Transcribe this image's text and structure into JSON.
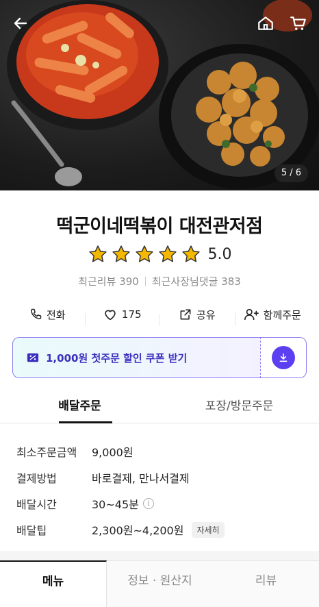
{
  "hero": {
    "counter": "5 / 6",
    "icons": {
      "back": "back-arrow-icon",
      "home": "home-icon",
      "cart": "cart-icon"
    }
  },
  "store": {
    "name": "떡군이네떡볶이 대전관저점",
    "rating": "5.0",
    "stars": 5,
    "recent_reviews": "최근리뷰 390",
    "owner_replies": "최근사장님댓글 383"
  },
  "actions": {
    "phone": "전화",
    "like_count": "175",
    "share": "공유",
    "group_order": "함께주문"
  },
  "coupon": {
    "label": "1,000원 첫주문 할인 쿠폰 받기"
  },
  "order_tabs": [
    "배달주문",
    "포장/방문주문"
  ],
  "info": {
    "min_order_label": "최소주문금액",
    "min_order_value": "9,000원",
    "payment_label": "결제방법",
    "payment_value": "바로결제, 만나서결제",
    "delivery_time_label": "배달시간",
    "delivery_time_value": "30~45분",
    "tip_label": "배달팁",
    "tip_value": "2,300원~4,200원",
    "detail_button": "자세히"
  },
  "bottom_tabs": [
    "메뉴",
    "정보 · 원산지",
    "리뷰"
  ],
  "colors": {
    "accent": "#5b3ff0",
    "star": "#f5b800",
    "coupon_text": "#3a2fbf"
  }
}
